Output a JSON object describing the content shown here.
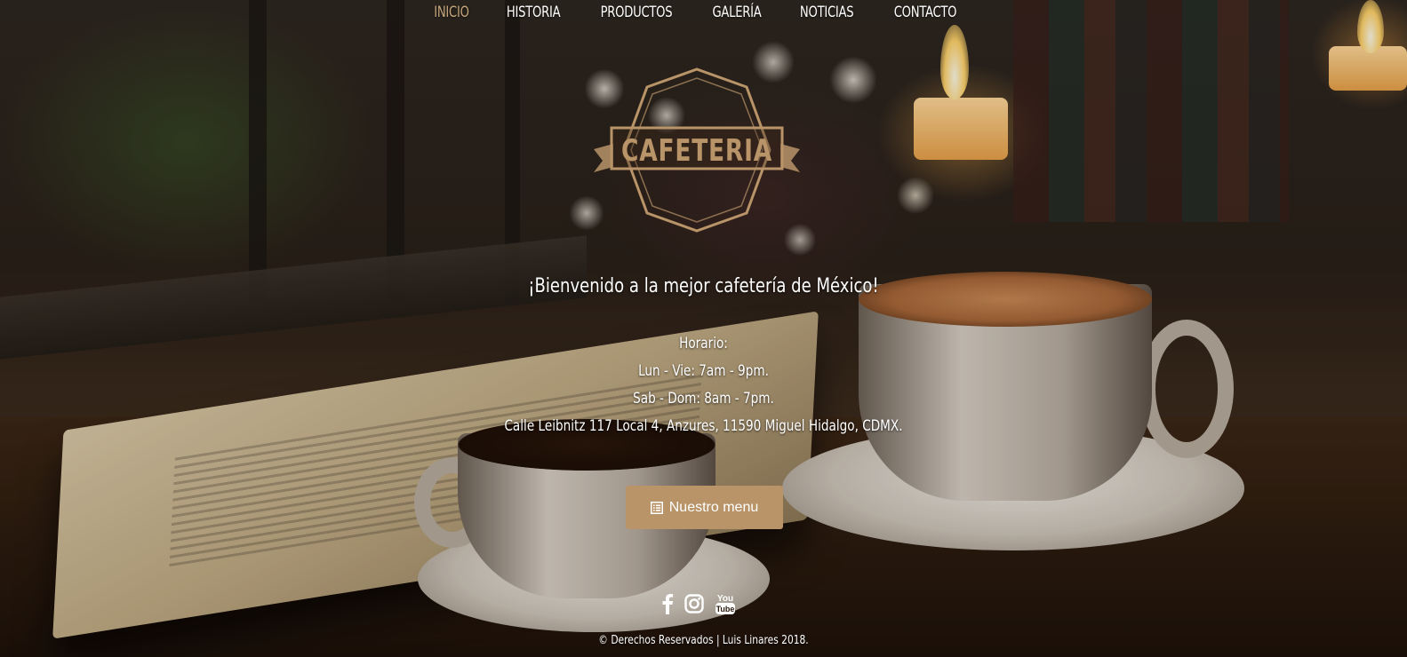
{
  "nav": {
    "items": [
      {
        "label": "Inicio"
      },
      {
        "label": "Historia"
      },
      {
        "label": "Productos"
      },
      {
        "label": "Galería"
      },
      {
        "label": "Noticias"
      },
      {
        "label": "Contacto"
      }
    ],
    "active_index": 0
  },
  "logo": {
    "text": "CAFETERIA"
  },
  "hero": {
    "welcome": "¡Bienvenido a la mejor cafetería de México!",
    "schedule_title": "Horario:",
    "weekdays": "Lun - Vie: 7am - 9pm.",
    "weekend": "Sab - Dom: 8am - 7pm.",
    "address": "Calle Leibnitz 117 Local 4, Anzures, 11590 Miguel Hidalgo, CDMX."
  },
  "menu_button": {
    "label": "Nuestro menu",
    "icon": "list-icon"
  },
  "social": [
    {
      "name": "facebook-icon"
    },
    {
      "name": "instagram-icon"
    },
    {
      "name": "youtube-icon"
    }
  ],
  "footer": {
    "copyright": "© Derechos Reservados | Luis Linares 2018."
  },
  "colors": {
    "accent": "#b89468",
    "active_nav": "#c5a77d",
    "text": "#ffffff"
  }
}
